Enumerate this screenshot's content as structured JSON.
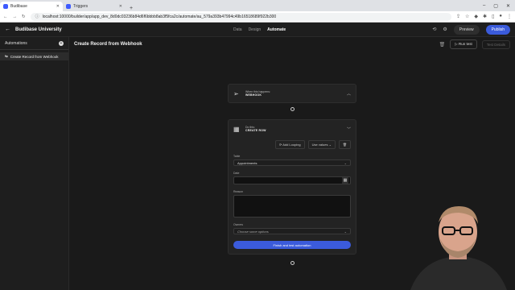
{
  "browser": {
    "tabs": [
      {
        "label": "Budibase",
        "active": true
      },
      {
        "label": "Triggers",
        "active": false
      }
    ],
    "url": "localhost:10000/builder/app/app_dev_8d0dc03236b84d6f6bbbb8ab3f5fca2c/automate/au_579a393b47994c49b16518689f922b300"
  },
  "app": {
    "name": "Budibase University",
    "nav_tabs": [
      "Data",
      "Design",
      "Automate"
    ],
    "active_tab": "Automate",
    "preview_label": "Preview",
    "publish_label": "Publish"
  },
  "sidebar": {
    "heading": "Automations",
    "items": [
      {
        "label": "Create Record from Webhook"
      }
    ]
  },
  "main": {
    "title": "Create Record from Webhook",
    "run_test_label": "Run test",
    "test_details_label": "Test Details"
  },
  "trigger_card": {
    "subtitle": "When this happens:",
    "title": "WEBHOOK"
  },
  "action_card": {
    "subtitle": "Do this:",
    "title": "CREATE ROW",
    "add_looping_label": "Add Looping",
    "use_values_label": "Use values",
    "table_label": "Table",
    "table_value": "Appointments",
    "date_label": "Date",
    "reason_label": "Reason",
    "owners_label": "Owners",
    "owners_placeholder": "Choose some options",
    "finish_label": "Finish and test automation"
  },
  "colors": {
    "accent": "#3b5bdb",
    "background": "#1a1a1a"
  }
}
